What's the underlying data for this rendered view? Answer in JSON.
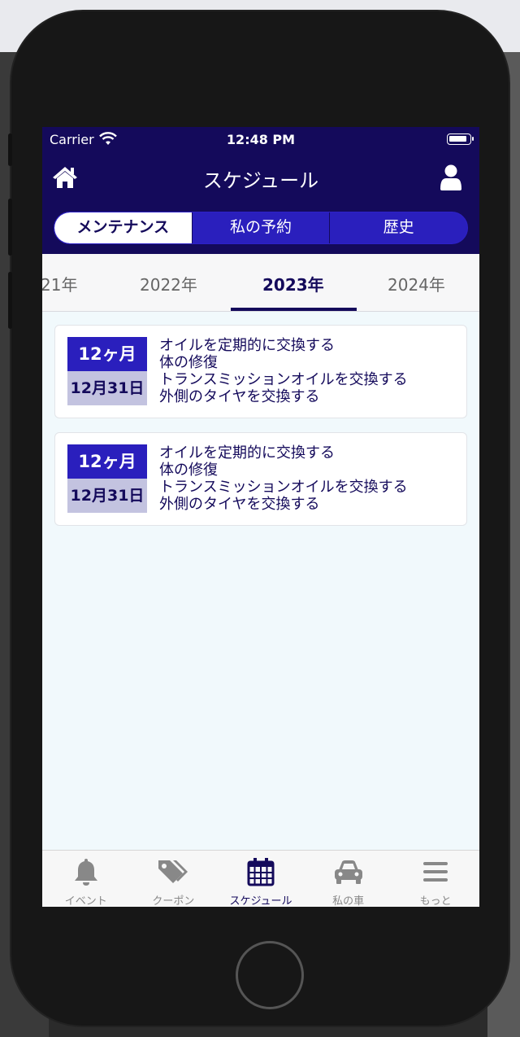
{
  "status": {
    "carrier": "Carrier",
    "time": "12:48 PM"
  },
  "header": {
    "title": "スケジュール"
  },
  "segments": [
    {
      "label": "メンテナンス",
      "active": true
    },
    {
      "label": "私の予約",
      "active": false
    },
    {
      "label": "歴史",
      "active": false
    }
  ],
  "years": [
    {
      "label": "21年",
      "active": false
    },
    {
      "label": "2022年",
      "active": false
    },
    {
      "label": "2023年",
      "active": true
    },
    {
      "label": "2024年",
      "active": false
    }
  ],
  "cards": [
    {
      "interval": "12ヶ月",
      "date": "12月31日",
      "tasks": [
        "オイルを定期的に交換する",
        "体の修復",
        "トランスミッションオイルを交換する",
        "外側のタイヤを交換する"
      ]
    },
    {
      "interval": "12ヶ月",
      "date": "12月31日",
      "tasks": [
        "オイルを定期的に交換する",
        "体の修復",
        "トランスミッションオイルを交換する",
        "外側のタイヤを交換する"
      ]
    }
  ],
  "tabs": [
    {
      "label": "イベント",
      "icon": "bell-icon",
      "active": false
    },
    {
      "label": "クーポン",
      "icon": "tags-icon",
      "active": false
    },
    {
      "label": "スケジュール",
      "icon": "calendar-icon",
      "active": true
    },
    {
      "label": "私の車",
      "icon": "car-icon",
      "active": false
    },
    {
      "label": "もっと",
      "icon": "menu-icon",
      "active": false
    }
  ],
  "colors": {
    "primary": "#140a5b",
    "accent": "#2a1fbd",
    "badge_light": "#c3c3e0",
    "background": "#f1f9fc"
  }
}
